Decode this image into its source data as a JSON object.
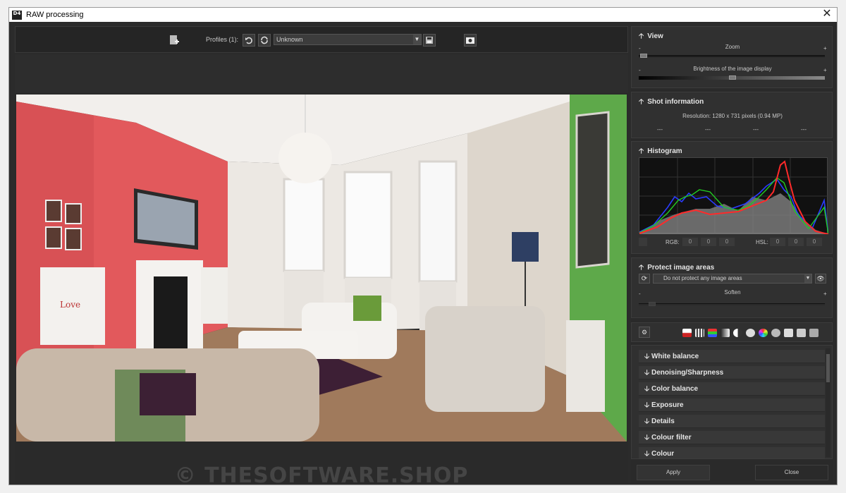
{
  "window": {
    "title": "RAW processing",
    "icon_text": "D4",
    "close_glyph": "✕"
  },
  "toolbar": {
    "profiles_label": "Profiles (1):",
    "profile_value": "Unknown"
  },
  "watermark": "© THESOFTWARE.SHOP",
  "view": {
    "title": "View",
    "zoom_label": "Zoom",
    "zoom_level": 0.0,
    "brightness_label": "Brightness of the image display",
    "brightness_level": 0.5,
    "minus": "-",
    "plus": "+"
  },
  "shot_info": {
    "title": "Shot information",
    "resolution": "Resolution: 1280 x 731 pixels (0.94 MP)",
    "fields": [
      "---",
      "---",
      "---",
      "---"
    ]
  },
  "histogram": {
    "title": "Histogram",
    "rgb_label": "RGB:",
    "rgb_values": [
      "0",
      "0",
      "0"
    ],
    "hsl_label": "HSL:",
    "hsl_values": [
      "0",
      "0",
      "0"
    ]
  },
  "protect": {
    "title": "Protect image areas",
    "select_value": "Do not protect any image areas",
    "soften_label": "Soften"
  },
  "sections": [
    {
      "label": "White balance"
    },
    {
      "label": "Denoising/Sharpness"
    },
    {
      "label": "Color balance"
    },
    {
      "label": "Exposure"
    },
    {
      "label": "Details"
    },
    {
      "label": "Colour filter"
    },
    {
      "label": "Colour"
    }
  ],
  "footer": {
    "apply_label": "Apply",
    "close_label": "Close"
  },
  "colors": {
    "accent_red": "#ff2a2a",
    "accent_green": "#22cc22",
    "accent_blue": "#2244ff"
  }
}
